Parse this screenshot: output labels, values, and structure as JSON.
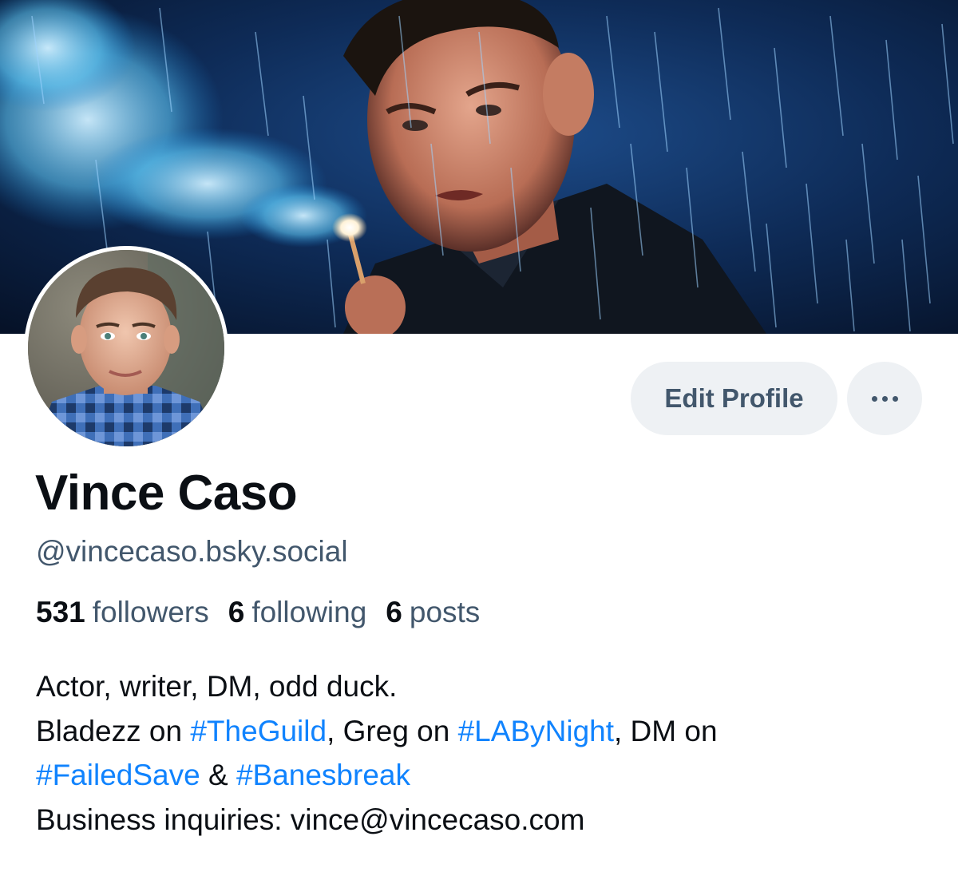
{
  "profile": {
    "display_name": "Vince Caso",
    "handle": "@vincecaso.bsky.social"
  },
  "actions": {
    "edit_profile_label": "Edit Profile",
    "more_icon": "more-horizontal-icon"
  },
  "stats": {
    "followers_count": "531",
    "followers_label": "followers",
    "following_count": "6",
    "following_label": "following",
    "posts_count": "6",
    "posts_label": "posts"
  },
  "bio": {
    "line1": "Actor, writer, DM, odd duck.",
    "line2_a": "Bladezz on ",
    "tag_theguild": "#TheGuild",
    "line2_b": ", Greg on ",
    "tag_labynight": "#LAByNight",
    "line2_c": ", DM on",
    "tag_failedsave": "#FailedSave",
    "line3_b": " & ",
    "tag_banesbreak": "#Banesbreak",
    "line4": "Business inquiries: vince@vincecaso.com"
  },
  "colors": {
    "link": "#1083fe",
    "text": "#0b0f14",
    "muted": "#42576c",
    "button_bg": "#eef1f4"
  }
}
